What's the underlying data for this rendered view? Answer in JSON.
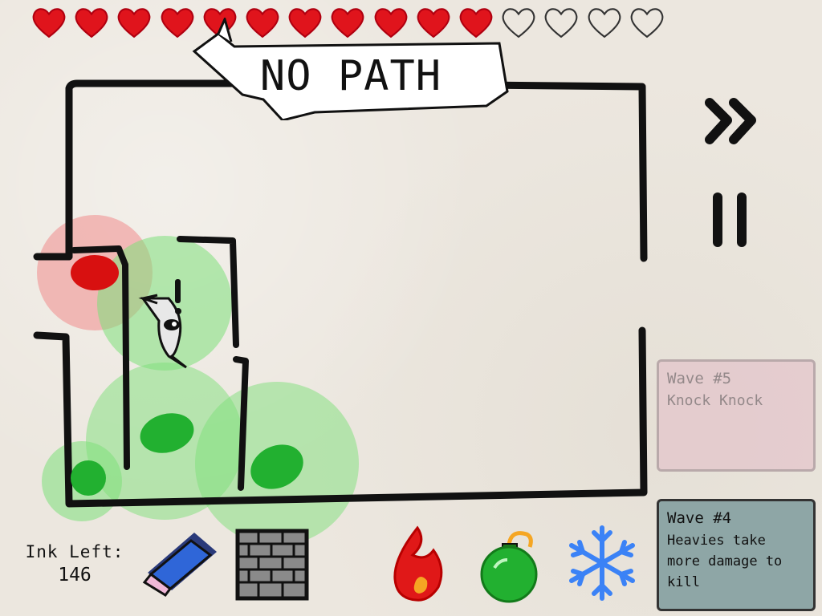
{
  "hud": {
    "lives_total": 15,
    "lives_filled": 11,
    "heart_color": "#e0141c",
    "empty_heart_color": "#333333"
  },
  "banner": {
    "text": "NO PATH"
  },
  "controls": {
    "fast_forward_icon": "fast-forward-icon",
    "pause_icon": "pause-icon"
  },
  "ink": {
    "label": "Ink Left:",
    "value": "146"
  },
  "tools": [
    {
      "name": "eraser",
      "icon": "eraser-icon"
    },
    {
      "name": "wall",
      "icon": "brick-wall-icon"
    },
    {
      "name": "fire",
      "icon": "fire-icon"
    },
    {
      "name": "bomb",
      "icon": "bomb-icon"
    },
    {
      "name": "ice",
      "icon": "snowflake-icon"
    }
  ],
  "waves": {
    "next": {
      "title": "Wave #5",
      "desc": "Knock Knock"
    },
    "current": {
      "title": "Wave #4",
      "desc": "Heavies take more damage to kill"
    }
  },
  "colors": {
    "ink": "#111111",
    "range_green": "#7ee07a",
    "range_red": "#f08c8c",
    "tower_green": "#22b030",
    "tower_red": "#d81010"
  }
}
